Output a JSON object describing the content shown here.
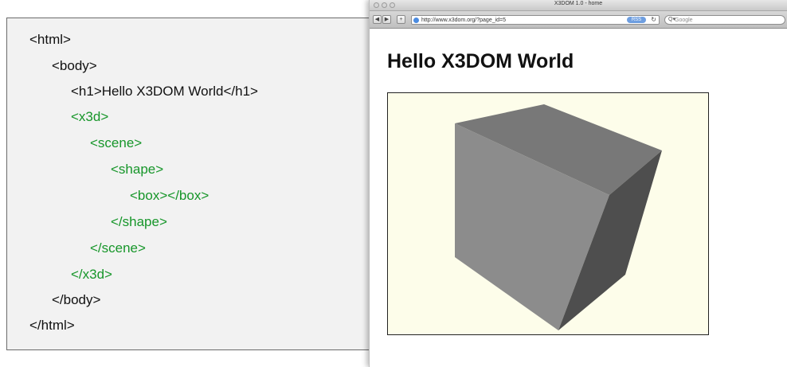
{
  "code_panel": {
    "lines": [
      {
        "text": "<html>",
        "color": "black"
      },
      {
        "text": "<body>",
        "color": "black"
      },
      {
        "text": "<h1>Hello X3DOM World</h1>",
        "color": "black"
      },
      {
        "text": "<x3d>",
        "color": "green"
      },
      {
        "text": "<scene>",
        "color": "green"
      },
      {
        "text": "<shape>",
        "color": "green"
      },
      {
        "text": "<box></box>",
        "color": "green"
      },
      {
        "text": "</shape>",
        "color": "green"
      },
      {
        "text": "</scene>",
        "color": "green"
      },
      {
        "text": "</x3d>",
        "color": "green"
      },
      {
        "text": "</body>",
        "color": "black"
      },
      {
        "text": "</html>",
        "color": "black"
      }
    ],
    "colors": {
      "green": "#17962a",
      "black": "#111111"
    }
  },
  "browser": {
    "window_title": "X3DOM 1.0 - home",
    "address": "http://www.x3dom.org/?page_id=5",
    "rss_label": "RSS",
    "search_placeholder": "Google",
    "page_heading": "Hello X3DOM World",
    "canvas_background": "#fdfdea",
    "icons": {
      "back": "back-arrow-icon",
      "forward": "forward-arrow-icon",
      "add": "add-bookmark-icon",
      "globe": "globe-icon",
      "reload": "reload-icon",
      "search": "search-icon"
    }
  }
}
